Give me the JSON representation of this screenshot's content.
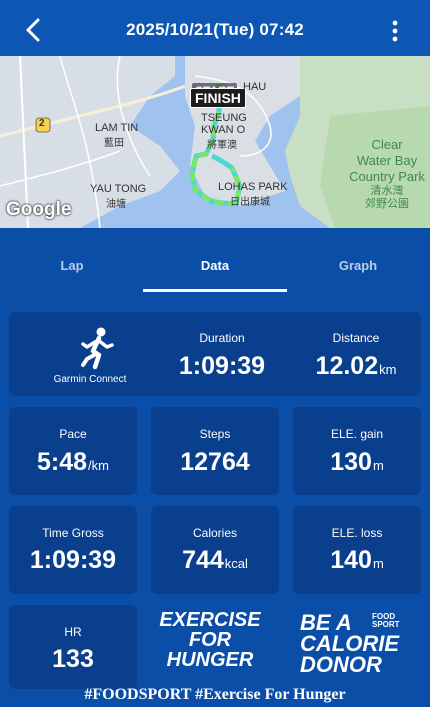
{
  "header": {
    "title": "2025/10/21(Tue) 07:42"
  },
  "map": {
    "labels": {
      "start": "START",
      "finish": "FINISH",
      "hau": "HAU",
      "lam_tin": "LAM TIN",
      "lam_tin_zh": "藍田",
      "tseung_kwan_o": "TSEUNG",
      "tseung_kwan_o_2": "KWAN O",
      "tseung_kwan_o_zh": "將軍澳",
      "yau_tong": "YAU TONG",
      "yau_tong_zh": "油塘",
      "lohas_park": "LOHAS PARK",
      "lohas_park_zh": "日出康城",
      "clear_water_bay_1": "Clear",
      "clear_water_bay_2": "Water Bay",
      "clear_water_bay_3": "Country Park",
      "clear_water_bay_zh_1": "清水灣",
      "clear_water_bay_zh_2": "郊野公園",
      "route_2": "2",
      "google": "Google"
    }
  },
  "tabs": [
    {
      "label": "Lap",
      "active": false
    },
    {
      "label": "Data",
      "active": true
    },
    {
      "label": "Graph",
      "active": false
    }
  ],
  "stats": {
    "source": "Garmin Connect",
    "duration": {
      "label": "Duration",
      "value": "1:09:39"
    },
    "distance": {
      "label": "Distance",
      "value": "12.02",
      "unit": "km"
    },
    "pace": {
      "label": "Pace",
      "value": "5:48",
      "unit": "/km"
    },
    "steps": {
      "label": "Steps",
      "value": "12764"
    },
    "ele_gain": {
      "label": "ELE. gain",
      "value": "130",
      "unit": "m"
    },
    "time_gross": {
      "label": "Time Gross",
      "value": "1:09:39"
    },
    "calories": {
      "label": "Calories",
      "value": "744",
      "unit": "kcal"
    },
    "ele_loss": {
      "label": "ELE. loss",
      "value": "140",
      "unit": "m"
    },
    "hr": {
      "label": "HR",
      "value": "133"
    }
  },
  "promo": {
    "exercise_1": "EXERCISE",
    "exercise_2": "FOR",
    "exercise_3": "HUNGER",
    "donor_1": "BE A",
    "donor_2": "CALORIE",
    "donor_3": "DONOR",
    "brand_1": "FOOD",
    "brand_2": "SPORT"
  },
  "footer": "#FOODSPORT #Exercise For Hunger",
  "colors": {
    "background": "#0b4ea8",
    "card": "#0a3f8d",
    "route": "#7ee85a"
  }
}
